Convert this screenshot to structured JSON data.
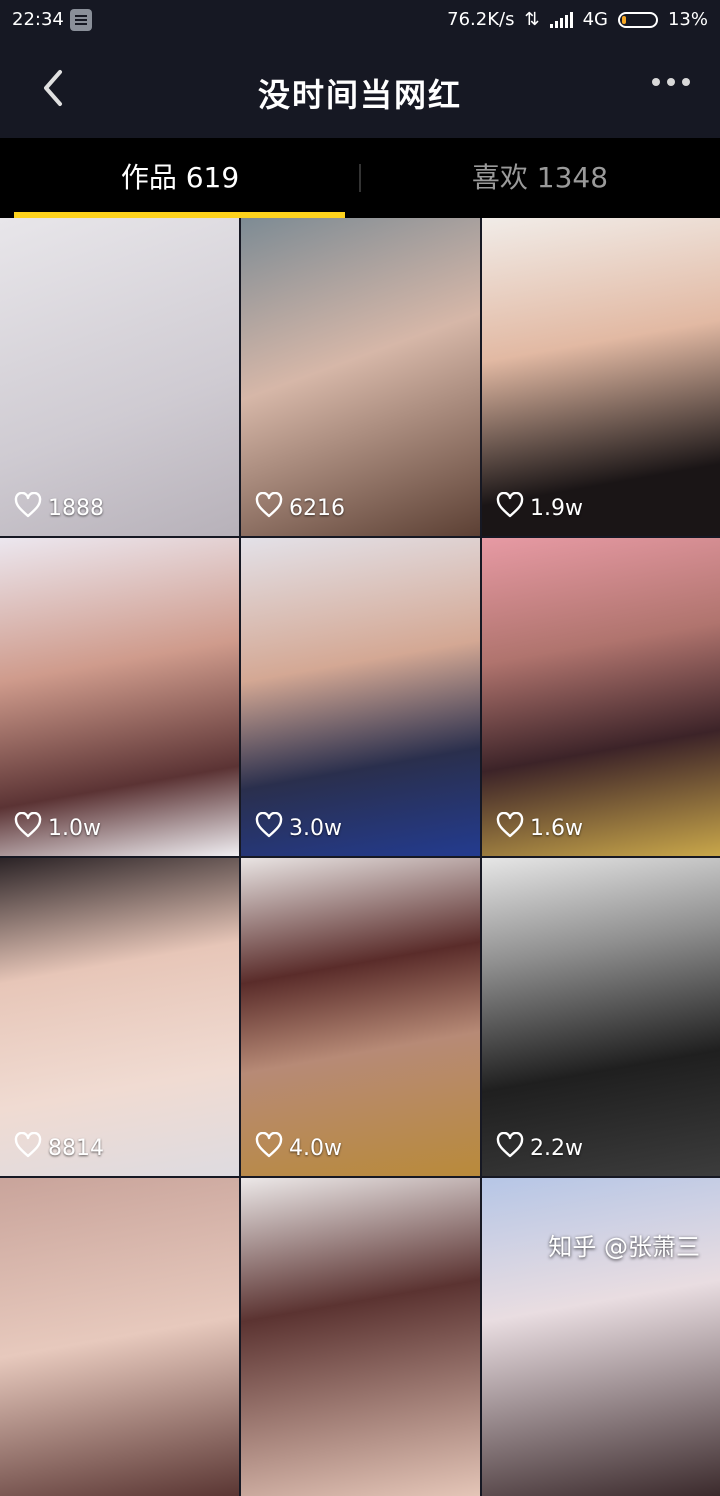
{
  "status_bar": {
    "time": "22:34",
    "network_speed": "76.2K/s",
    "network_type": "4G",
    "battery": "13%",
    "battery_level": 0.13,
    "accent": "#f5a623"
  },
  "header": {
    "title": "没时间当网红",
    "back_icon": "chevron-left-icon",
    "more_icon": "more-horizontal-icon"
  },
  "tabs": [
    {
      "label": "作品 619",
      "active": true
    },
    {
      "label": "喜欢 1348",
      "active": false
    }
  ],
  "indicator_color": "#fdd21d",
  "videos": [
    {
      "likes": "1888",
      "bg": "linear-gradient(160deg,#e8e6ea 0%,#cfcbd2 60%,#b7b1b9 100%)"
    },
    {
      "likes": "6216",
      "bg": "linear-gradient(160deg,#7d8b94 0%,#d6b7a8 45%,#5c4034 100%)"
    },
    {
      "likes": "1.9w",
      "bg": "linear-gradient(170deg,#f1ece8 0%,#e2b9a3 40%,#1a1516 80%)"
    },
    {
      "likes": "1.0w",
      "bg": "linear-gradient(170deg,#ece7ef 0%,#cf9b8c 40%,#5b3334 75%,#f0eef2 100%)"
    },
    {
      "likes": "3.0w",
      "bg": "linear-gradient(170deg,#e3e1e8 0%,#d4a894 40%,#2a2f4d 70%,#233b8f 100%)"
    },
    {
      "likes": "1.6w",
      "bg": "linear-gradient(170deg,#e79aa4 0%,#b0746e 35%,#3c2328 65%,#c9a74a 100%)"
    },
    {
      "likes": "8814",
      "bg": "linear-gradient(170deg,#2b2326 0%,#e7c6b8 35%,#f0dbd2 70%,#dedbe0 100%)"
    },
    {
      "likes": "4.0w",
      "bg": "linear-gradient(170deg,#e9e4e3 0%,#5a2c2a 35%,#b78a76 60%,#b98a3a 100%)"
    },
    {
      "likes": "2.2w",
      "bg": "linear-gradient(170deg,#e6e6e6 0%,#8f8f8f 30%,#1f1f1f 65%,#3c3c3c 100%)"
    },
    {
      "likes": "",
      "bg": "linear-gradient(170deg,#c9a49b 0%,#e7c9bd 50%,#5a3633 100%)"
    },
    {
      "likes": "",
      "bg": "linear-gradient(170deg,#ece8e8 0%,#5b3331 40%,#e4c5b7 100%)"
    },
    {
      "likes": "",
      "bg": "linear-gradient(170deg,#b6c6e6 0%,#e9dde1 40%,#3b2a2c 100%)"
    }
  ],
  "watermark": "知乎 @张萧三"
}
